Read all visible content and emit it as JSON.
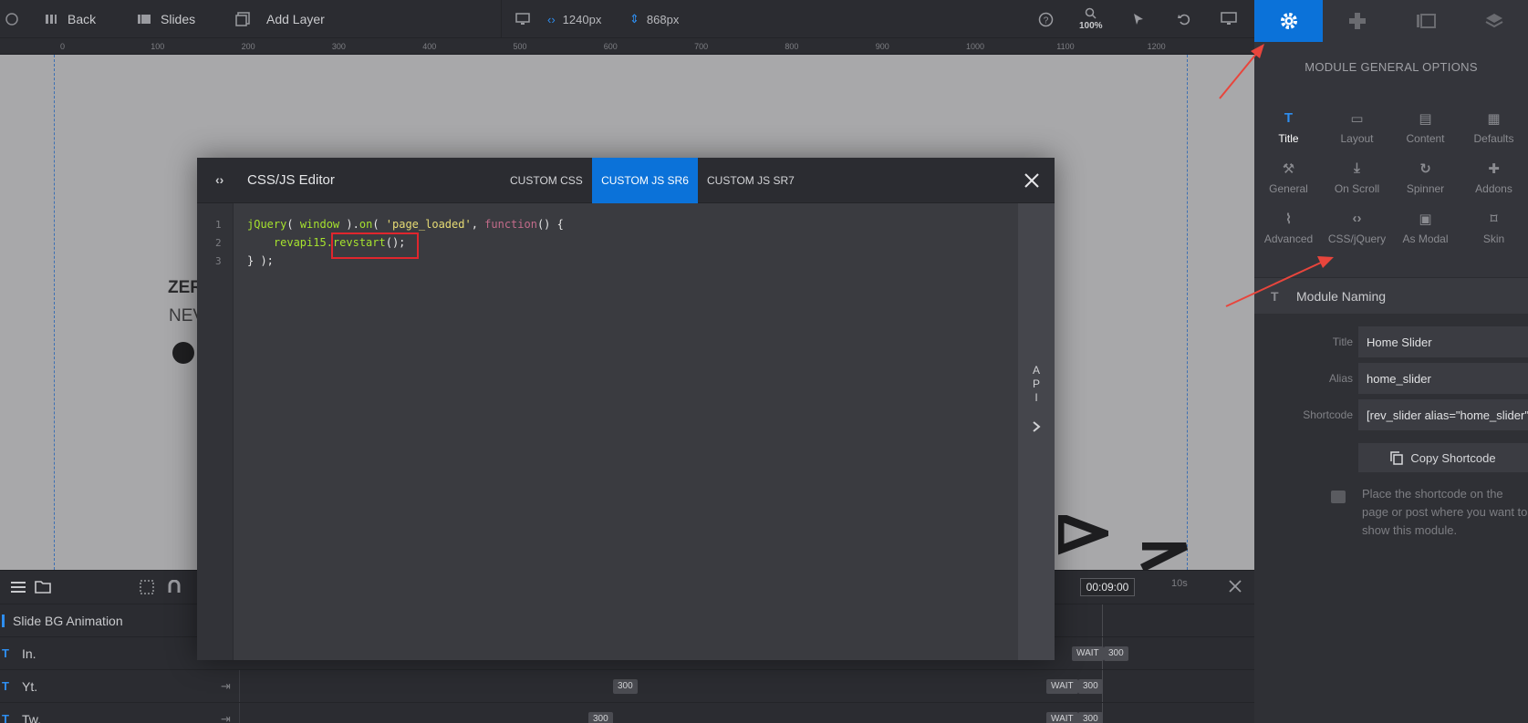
{
  "topbar": {
    "back_label": "Back",
    "slides_label": "Slides",
    "add_layer_label": "Add Layer",
    "width_value": "1240px",
    "height_value": "868px",
    "zoom_value": "100%"
  },
  "ruler": {
    "ticks": [
      "0",
      "100",
      "200",
      "300",
      "400",
      "500",
      "600",
      "700",
      "800",
      "900",
      "1000",
      "1100",
      "1200"
    ]
  },
  "canvas": {
    "text1": "ZER",
    "text2": "NEV"
  },
  "modal": {
    "title": "CSS/JS Editor",
    "tabs": [
      "CUSTOM CSS",
      "CUSTOM JS SR6",
      "CUSTOM JS SR7"
    ],
    "active_tab": "CUSTOM JS SR6",
    "line_numbers": [
      "1",
      "2",
      "3"
    ],
    "code": {
      "l1_a": "jQuery",
      "l1_b": "( ",
      "l1_c": "window",
      "l1_d": " ).",
      "l1_e": "on",
      "l1_f": "( ",
      "l1_g": "'page_loaded'",
      "l1_h": ", ",
      "l1_i": "function",
      "l1_j": "() {",
      "l2_a": "    revapi15.",
      "l2_b": "revstart",
      "l2_c": "();",
      "l3": "} );"
    },
    "api_letters": [
      "A",
      "P",
      "I"
    ]
  },
  "timeline": {
    "time_value": "00:09:00",
    "end_marker": "10s",
    "rows": [
      {
        "label": "Slide BG Animation"
      },
      {
        "label": "In.",
        "badges": [
          "WAIT",
          "300"
        ]
      },
      {
        "label": "Yt.",
        "badges": [
          "300",
          "WAIT",
          "300"
        ]
      },
      {
        "label": "Tw.",
        "badges": [
          "300",
          "WAIT",
          "300"
        ]
      }
    ]
  },
  "panel": {
    "title": "MODULE GENERAL OPTIONS",
    "options": [
      {
        "label": "Title",
        "icon": "text-icon"
      },
      {
        "label": "Layout",
        "icon": "layout-icon"
      },
      {
        "label": "Content",
        "icon": "content-icon"
      },
      {
        "label": "Defaults",
        "icon": "defaults-icon"
      },
      {
        "label": "General",
        "icon": "wrench-icon"
      },
      {
        "label": "On Scroll",
        "icon": "scroll-icon"
      },
      {
        "label": "Spinner",
        "icon": "spinner-icon"
      },
      {
        "label": "Addons",
        "icon": "puzzle-icon"
      },
      {
        "label": "Advanced",
        "icon": "chart-icon"
      },
      {
        "label": "CSS/jQuery",
        "icon": "code-icon"
      },
      {
        "label": "As Modal",
        "icon": "modal-icon"
      },
      {
        "label": "Skin",
        "icon": "brush-icon"
      }
    ],
    "section": "Module Naming",
    "fields": {
      "title_label": "Title",
      "title_value": "Home Slider",
      "alias_label": "Alias",
      "alias_value": "home_slider",
      "shortcode_label": "Shortcode",
      "shortcode_value": "[rev_slider alias=\"home_slider\"][/rev_slider]"
    },
    "copy_button": "Copy Shortcode",
    "hint": "Place the shortcode on the page or post where you want to show this module."
  },
  "colors": {
    "accent": "#0b72d9",
    "highlight": "#e0262d",
    "arrow": "#e8453c"
  }
}
